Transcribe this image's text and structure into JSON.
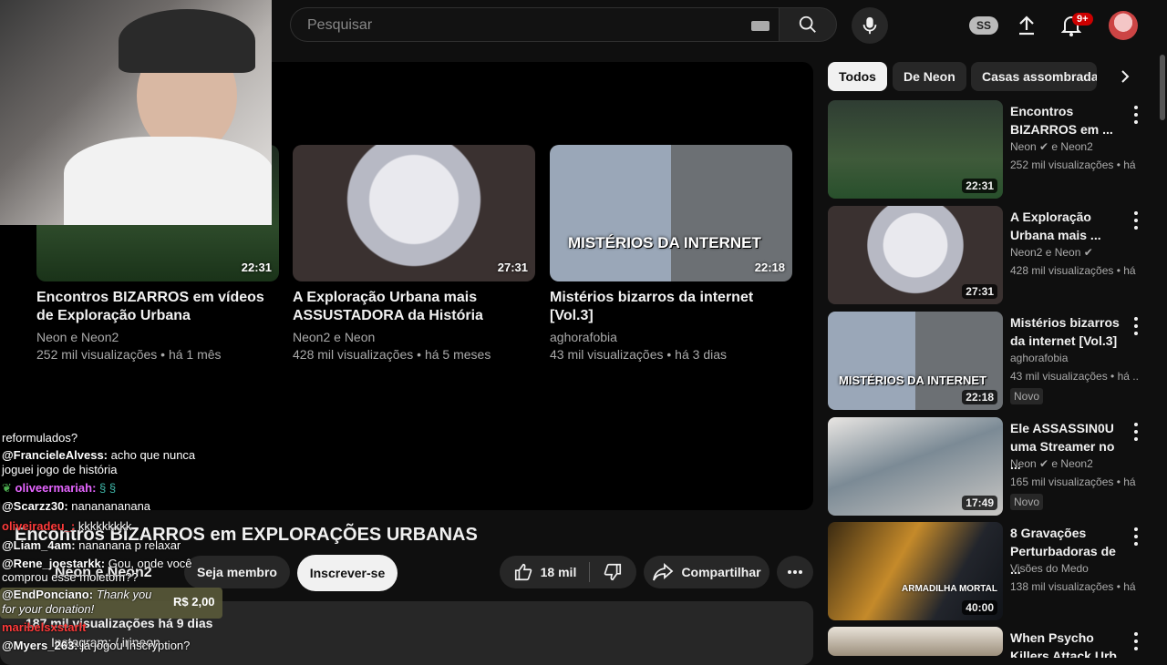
{
  "header": {
    "search_placeholder": "Pesquisar",
    "ss_badge": "SS",
    "notif_count": "9+"
  },
  "end_cards": [
    {
      "title": "Encontros BIZARROS em vídeos de Exploração Urbana",
      "channel": "Neon e Neon2",
      "meta": "252 mil visualizações • há 1 mês",
      "duration": "22:31"
    },
    {
      "title": "A Exploração Urbana mais ASSUSTADORA da História",
      "channel": "Neon2 e Neon",
      "meta": "428 mil visualizações • há 5 meses",
      "duration": "27:31"
    },
    {
      "title": "Mistérios bizarros da internet [Vol.3]",
      "channel": "aghorafobia",
      "meta": "43 mil visualizações • há 3 dias",
      "duration": "22:18",
      "thumb_text": "MISTÉRIOS DA INTERNET"
    }
  ],
  "video": {
    "title": "Encontros BIZARROS em EXPLORAÇÕES URBANAS",
    "channel": "Neon e Neon2",
    "join_label": "Seja membro",
    "subscribe_label": "Inscrever-se",
    "likes": "18 mil",
    "share_label": "Compartilhar",
    "views_date": "187 mil visualizações  há 9 dias",
    "desc_line": "Instagram:  / irineon"
  },
  "chat": [
    {
      "user": "",
      "text": "reformulados?"
    },
    {
      "user": "@FrancieleAlvess:",
      "text": "acho que nunca"
    },
    {
      "user": "",
      "text": "joguei jogo de história"
    },
    {
      "user": "oliveermariah:",
      "text": ""
    },
    {
      "user": "@Scarzz30:",
      "text": "nananananana"
    },
    {
      "user": "oliveiradeu_:",
      "text": "kkkkkkkkk"
    },
    {
      "user": "@Liam_4am:",
      "text": "nananana p relaxar"
    },
    {
      "user": "@Rene_joestarkk:",
      "text": "Gou, onde você"
    },
    {
      "user": "",
      "text": "comprou esse moletom??"
    },
    {
      "user": "@EndPonciano:",
      "text": "Thank you"
    },
    {
      "user": "",
      "text": "for your donation!"
    },
    {
      "user": "maribelsxstarlt",
      "text": ""
    },
    {
      "user": "@Myers_263:",
      "text": "já jogou Inscryption?"
    }
  ],
  "donation_amount": "R$ 2,00",
  "chips": [
    "Todos",
    "De Neon",
    "Casas assombradas"
  ],
  "recommendations": [
    {
      "title": "Encontros BIZARROS em ...",
      "channel": "Neon ✔ e Neon2",
      "meta": "252 mil visualizações • há ...",
      "duration": "22:31",
      "badge": ""
    },
    {
      "title": "A Exploração Urbana mais ...",
      "channel": "Neon2 e Neon ✔",
      "meta": "428 mil visualizações • há ...",
      "duration": "27:31",
      "badge": ""
    },
    {
      "title": "Mistérios bizarros da internet [Vol.3]",
      "channel": "aghorafobia",
      "meta": "43 mil visualizações • há ...",
      "duration": "22:18",
      "badge": "Novo",
      "thumb_text": "MISTÉRIOS DA INTERNET"
    },
    {
      "title": "Ele ASSASSIN0U uma Streamer no ...",
      "channel": "Neon ✔ e Neon2",
      "meta": "165 mil visualizações • há ...",
      "duration": "17:49",
      "badge": "Novo"
    },
    {
      "title": "8 Gravações Perturbadoras de ...",
      "channel": "Visões do Medo",
      "meta": "138 mil visualizações • há ...",
      "duration": "40:00",
      "badge": "",
      "thumb_text": "ARMADILHA MORTAL"
    },
    {
      "title": "When Psycho Killers Attack Urb...",
      "channel": "",
      "meta": "",
      "duration": "",
      "badge": ""
    }
  ]
}
